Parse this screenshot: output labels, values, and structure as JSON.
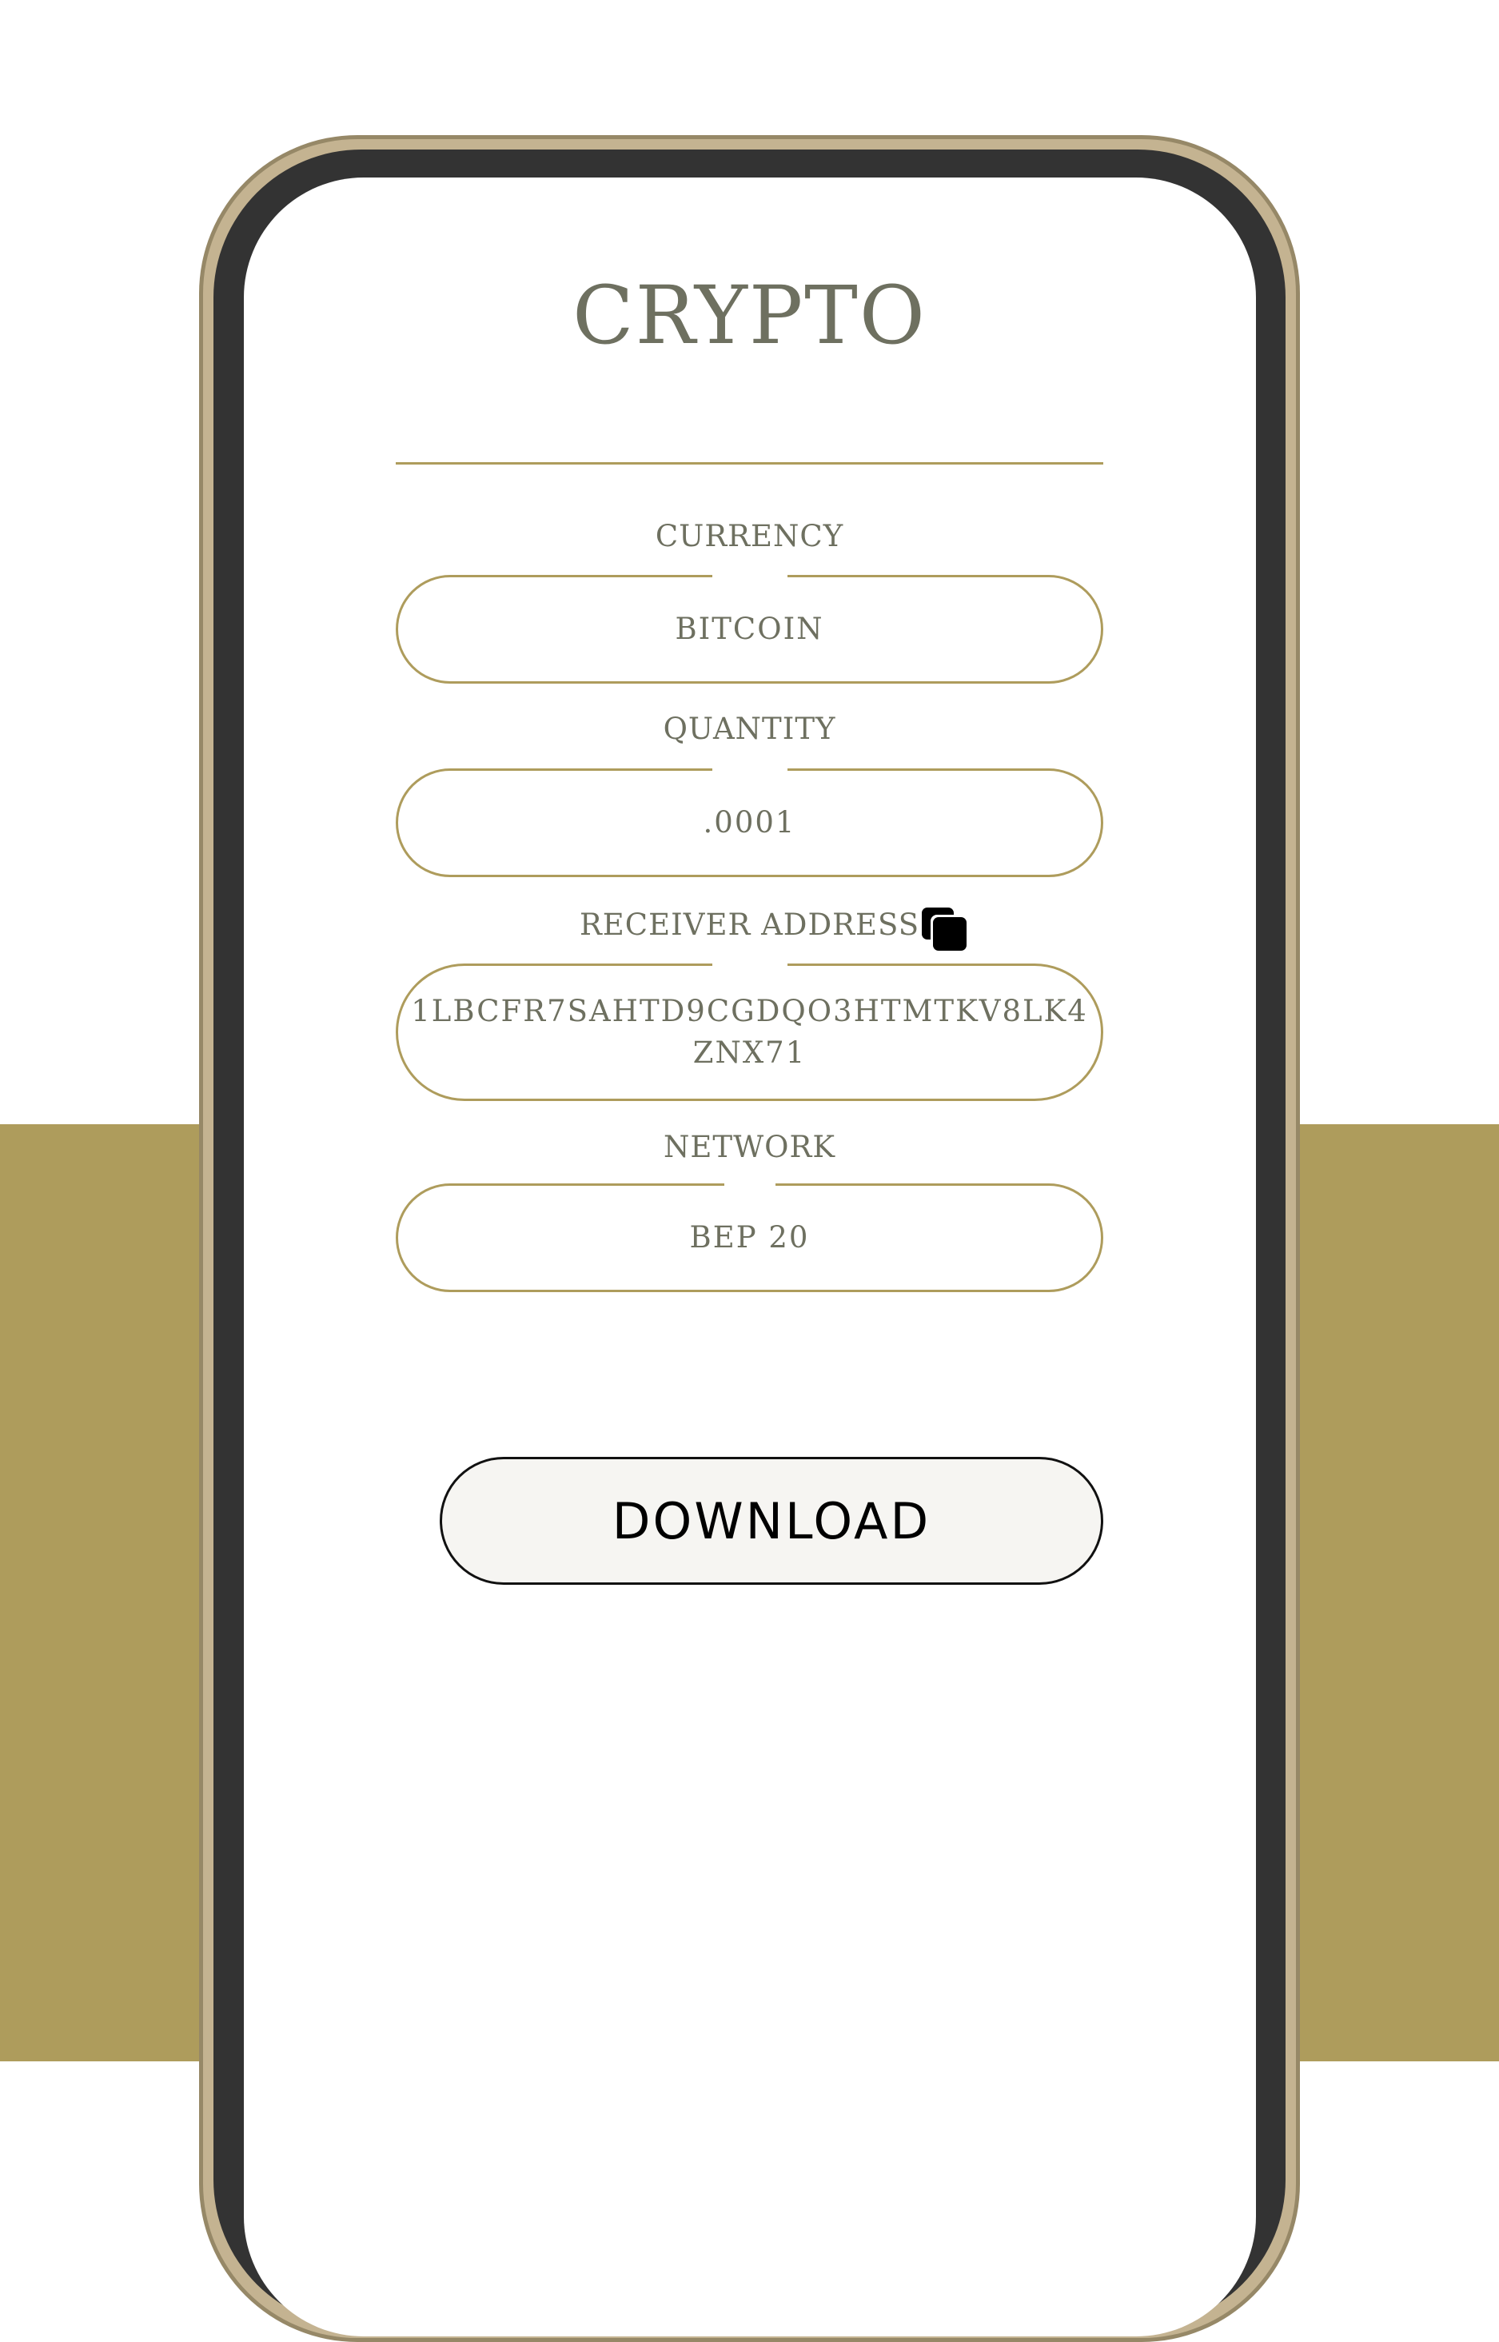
{
  "header": {
    "title": "CRYPTO"
  },
  "form": {
    "currency": {
      "label": "CURRENCY",
      "value": "BITCOIN"
    },
    "quantity": {
      "label": "QUANTITY",
      "value": ".0001"
    },
    "receiver_address": {
      "label": "RECEIVER ADDRESS",
      "value_line1": "1LBCFR7SAHTD9CGDQO3HTMTKV8LK4",
      "value_line2": "ZNX71",
      "copy_icon": "copy-icon"
    },
    "network": {
      "label": "NETWORK",
      "value": "BEP 20"
    }
  },
  "actions": {
    "download_label": "DOWNLOAD"
  },
  "colors": {
    "accent": "#ae9c5c",
    "text": "#6e7060",
    "bezel": "#333333",
    "frame": "#968867",
    "button_bg": "#f6f5f2"
  }
}
